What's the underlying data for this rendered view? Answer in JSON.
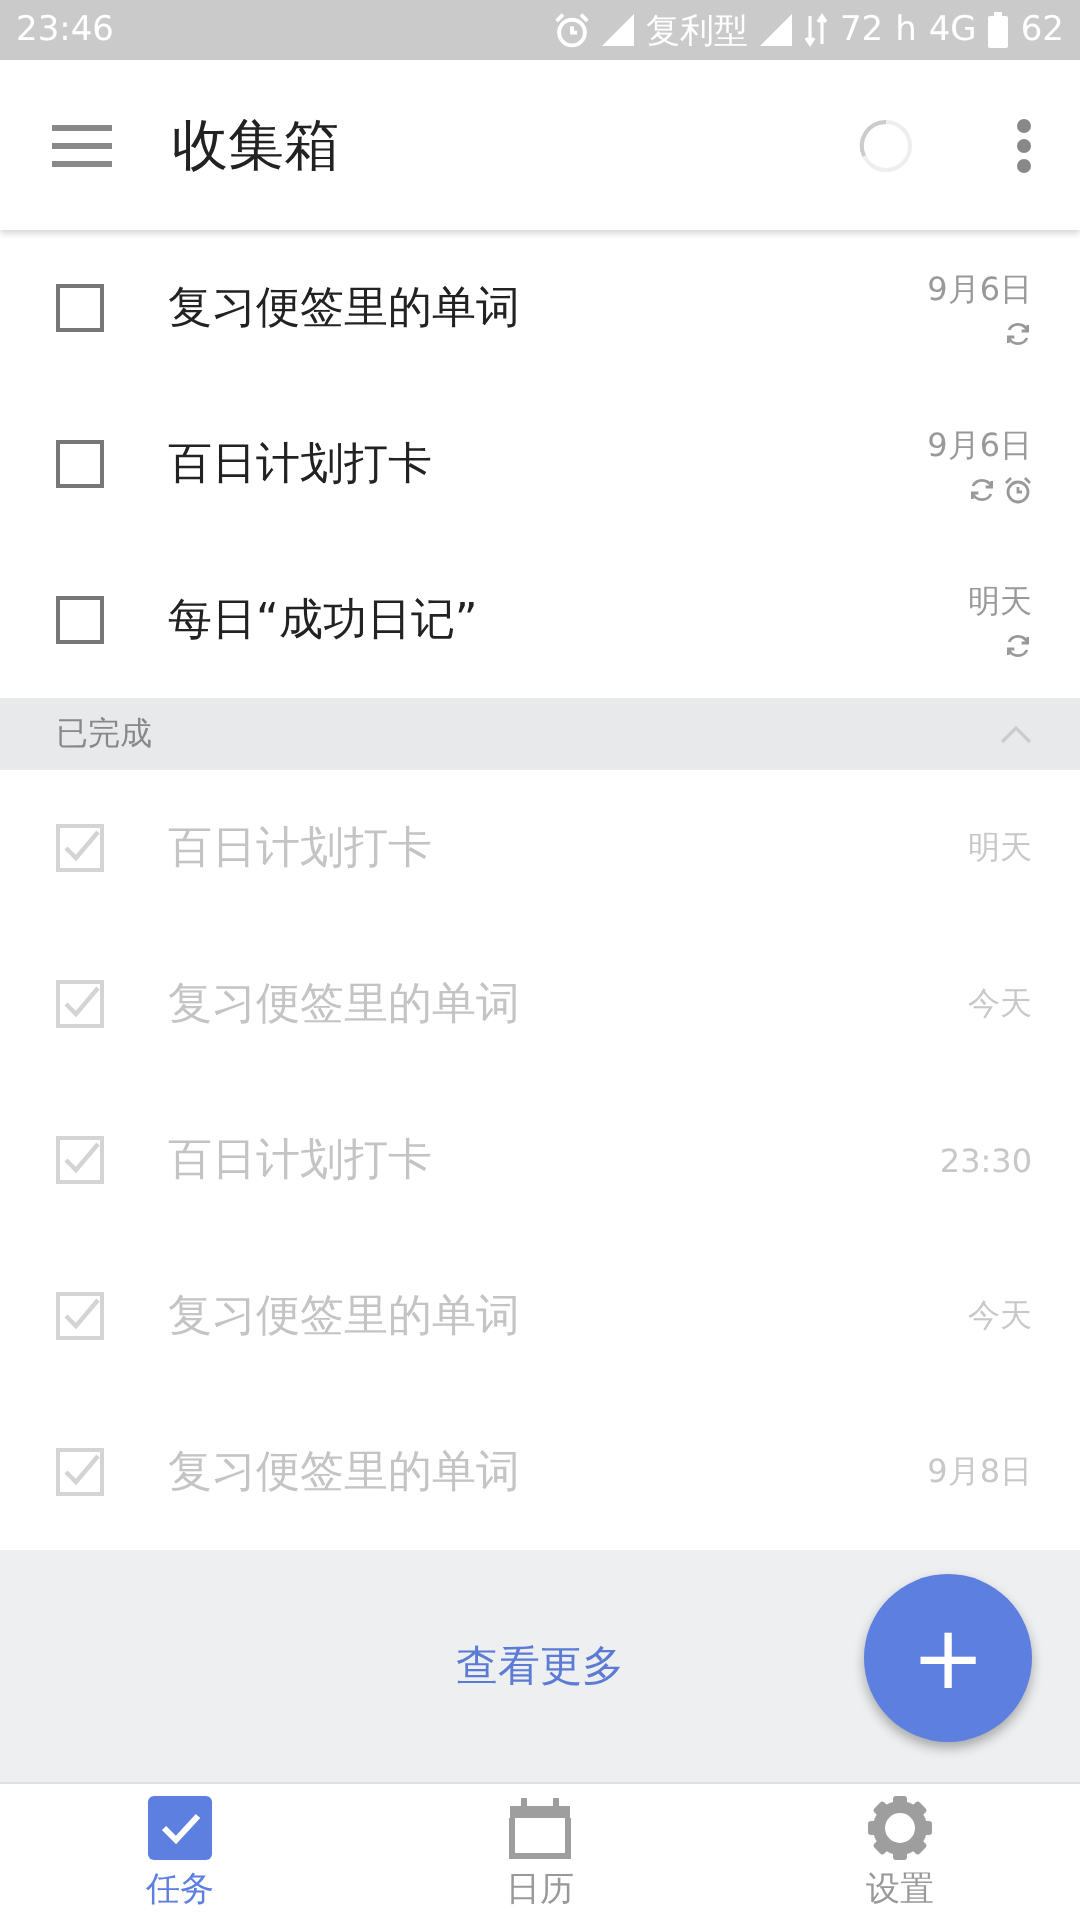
{
  "status_bar": {
    "time": "23:46",
    "carrier": "复利型",
    "speed": "72",
    "network_h": "h",
    "network": "4G",
    "battery": "62"
  },
  "app_bar": {
    "title": "收集箱",
    "loading": true
  },
  "tasks": [
    {
      "title": "复习便签里的单词",
      "date": "9月6日",
      "checked": false,
      "repeat": true,
      "alarm": false
    },
    {
      "title": "百日计划打卡",
      "date": "9月6日",
      "checked": false,
      "repeat": true,
      "alarm": true
    },
    {
      "title": "每日“成功日记”",
      "date": "明天",
      "checked": false,
      "repeat": true,
      "alarm": false
    }
  ],
  "completed": {
    "label": "已完成",
    "expanded": true,
    "tasks": [
      {
        "title": "百日计划打卡",
        "date": "明天",
        "checked": true
      },
      {
        "title": "复习便签里的单词",
        "date": "今天",
        "checked": true
      },
      {
        "title": "百日计划打卡",
        "date": "23:30",
        "checked": true
      },
      {
        "title": "复习便签里的单词",
        "date": "今天",
        "checked": true
      },
      {
        "title": "复习便签里的单词",
        "date": "9月8日",
        "checked": true
      }
    ]
  },
  "more_link": "查看更多",
  "fab": "+",
  "nav": [
    {
      "label": "任务",
      "kind": "tasks",
      "selected": true
    },
    {
      "label": "日历",
      "kind": "calendar",
      "selected": false
    },
    {
      "label": "设置",
      "kind": "settings",
      "selected": false
    }
  ]
}
